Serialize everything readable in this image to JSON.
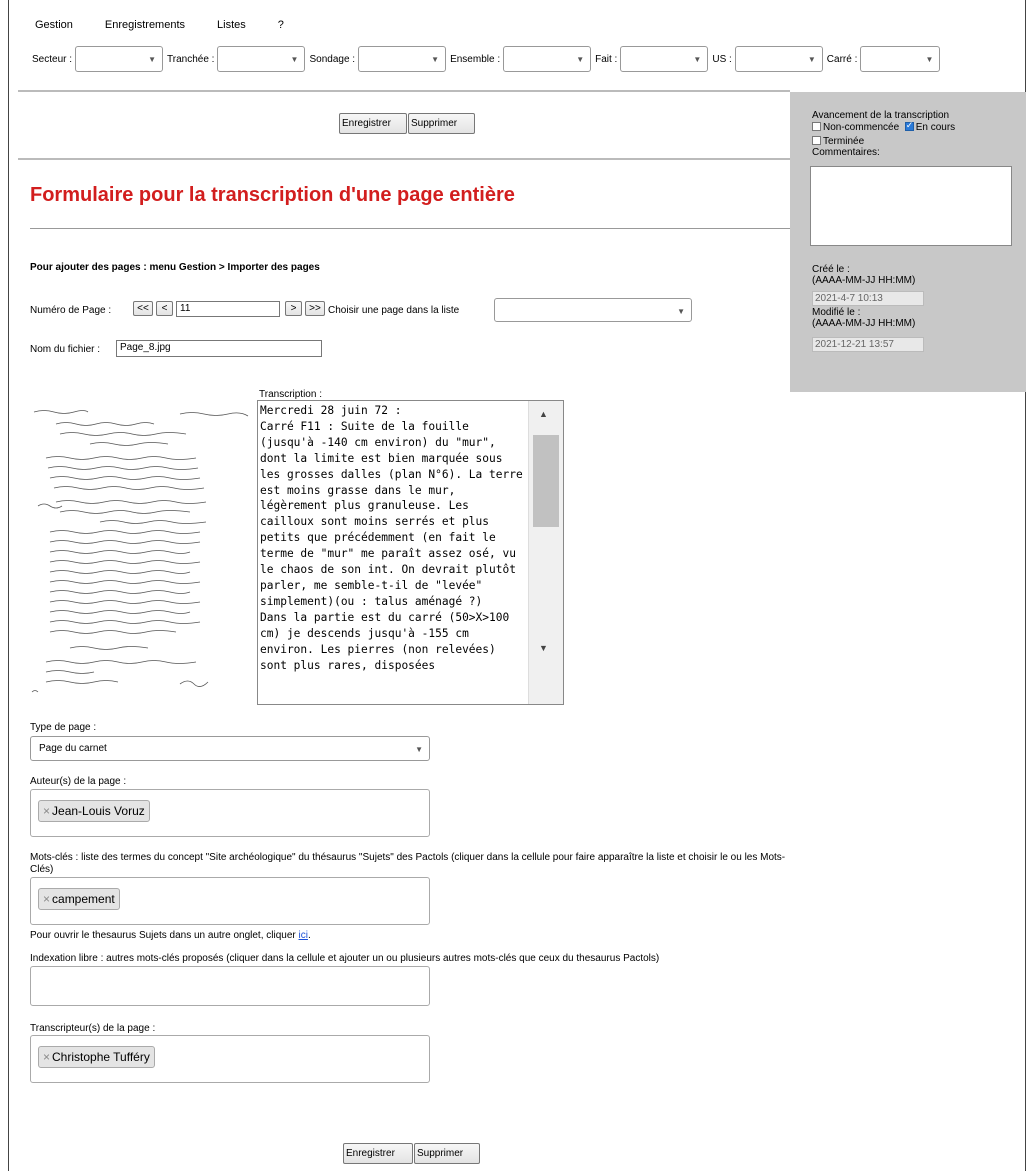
{
  "menu": [
    "Gestion",
    "Enregistrements",
    "Listes",
    "?"
  ],
  "filters": [
    "Secteur :",
    "Tranchée :",
    "Sondage :",
    "Ensemble :",
    "Fait :",
    "US :",
    "Carré :"
  ],
  "buttons": {
    "save": "Enregistrer",
    "delete": "Supprimer"
  },
  "sidebar": {
    "progress_label": "Avancement de la transcription",
    "opt_not_started": "Non-commencée",
    "opt_in_progress": "En cours",
    "opt_done": "Terminée",
    "comments_label": "Commentaires:",
    "created_label": "Créé le :",
    "created_format": "(AAAA-MM-JJ HH:MM)",
    "created_value": "2021-4-7 10:13",
    "modified_label": "Modifié le :",
    "modified_format": "(AAAA-MM-JJ HH:MM)",
    "modified_value": "2021-12-21 13:57"
  },
  "title": "Formulaire pour la transcription d'une page entière",
  "hint_add_pages": "Pour ajouter des pages : menu Gestion > Importer des pages",
  "page_nav": {
    "label": "Numéro de Page :",
    "first": "<<",
    "prev": "<",
    "value": "11",
    "next": ">",
    "last": ">>",
    "choose_label": "Choisir une page dans la liste"
  },
  "file": {
    "label": "Nom du fichier :",
    "value": "Page_8.jpg"
  },
  "transcription": {
    "label": "Transcription :",
    "text": "Mercredi 28 juin 72 :\nCarré F11 : Suite de la fouille (jusqu'à -140 cm environ) du \"mur\", dont la limite est bien marquée sous les grosses dalles (plan N°6). La terre est moins grasse dans le mur, légèrement plus granuleuse. Les cailloux sont moins serrés et plus petits que précédemment (en fait le terme de \"mur\" me paraît assez osé, vu\nle chaos de son int. On devrait plutôt parler, me semble-t-il de \"levée\" simplement)(ou : talus aménagé ?)\nDans la partie est du carré (50>X>100 cm) je descends jusqu'à -155 cm environ. Les pierres (non relevées) sont plus rares, disposées"
  },
  "page_type": {
    "label": "Type de page :",
    "value": "Page du carnet"
  },
  "authors": {
    "label": "Auteur(s) de la page :",
    "tag": "Jean-Louis Voruz"
  },
  "keywords": {
    "label": "Mots-clés : liste des termes du concept \"Site archéologique\" du thésaurus \"Sujets\" des Pactols (cliquer dans la cellule pour faire apparaître la liste et choisir le ou les Mots-Clés)",
    "tag": "campement",
    "note_prefix": "Pour ouvrir le thesaurus Sujets dans un autre onglet, cliquer ",
    "note_link": "ici",
    "note_suffix": "."
  },
  "free_index": {
    "label": "Indexation libre : autres mots-clés proposés (cliquer dans la cellule et ajouter un ou plusieurs autres mots-clés que ceux du thesaurus Pactols)"
  },
  "transcribers": {
    "label": "Transcripteur(s) de la page :",
    "tag": "Christophe Tufféry"
  },
  "tag_remove": "×"
}
